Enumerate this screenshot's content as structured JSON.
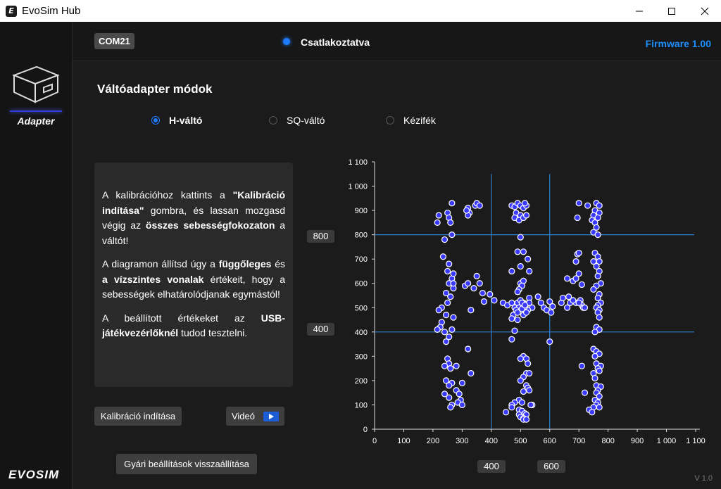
{
  "window": {
    "title": "EvoSim Hub",
    "icon": "app-logo-icon"
  },
  "sidebar": {
    "adapter_label": "Adapter",
    "brand": "EVOSIM"
  },
  "header": {
    "port": "COM21",
    "status": "Csatlakoztatva",
    "firmware": "Firmware 1.00",
    "status_color": "#1e7bff"
  },
  "main": {
    "title": "Váltóadapter módok",
    "modes": [
      {
        "label": "H-váltó",
        "selected": true
      },
      {
        "label": "SQ-váltó",
        "selected": false
      },
      {
        "label": "Kézifék",
        "selected": false
      }
    ],
    "info": {
      "p1_a": "A kalibrációhoz kattints a ",
      "p1_b": "\"Kalibráció indítása\"",
      "p1_c": " gombra, és lassan mozgasd végig az ",
      "p1_d": "összes sebességfokozaton",
      "p1_e": " a váltót!",
      "p2_a": "A diagramon állítsd úgy a ",
      "p2_b": "függőleges",
      "p2_c": " és ",
      "p2_d": "a vízszintes vonalak",
      "p2_e": " értékeit, hogy a sebességek elhatárolódjanak egymástól!",
      "p3_a": "A beállított értékeket az ",
      "p3_b": "USB-játékvezérlőknél",
      "p3_c": " tudod tesztelni."
    },
    "buttons": {
      "calibrate": "Kalibráció indítása",
      "video": "Videó",
      "reset": "Gyári beállítások visszaállítása"
    },
    "y_upper": "800",
    "y_lower": "400",
    "x_left": "400",
    "x_right": "600",
    "version": "V 1.0"
  },
  "chart_data": {
    "type": "scatter",
    "x_ticks": [
      "0",
      "100",
      "200",
      "300",
      "400",
      "500",
      "600",
      "700",
      "800",
      "900",
      "1 000",
      "1 100"
    ],
    "y_ticks": [
      "0",
      "100",
      "200",
      "300",
      "400",
      "500",
      "600",
      "700",
      "800",
      "900",
      "1 000",
      "1 100"
    ],
    "xlim": [
      0,
      1100
    ],
    "ylim": [
      0,
      1100
    ],
    "vertical_lines": [
      400,
      600
    ],
    "horizontal_lines": [
      400,
      800
    ],
    "line_color": "#2f7fd0",
    "point_color": "#3a3aff",
    "grid": false,
    "points": [
      [
        220,
        880
      ],
      [
        215,
        850
      ],
      [
        265,
        930
      ],
      [
        250,
        890
      ],
      [
        255,
        870
      ],
      [
        260,
        850
      ],
      [
        240,
        780
      ],
      [
        265,
        800
      ],
      [
        235,
        710
      ],
      [
        255,
        680
      ],
      [
        250,
        650
      ],
      [
        265,
        620
      ],
      [
        255,
        600
      ],
      [
        270,
        580
      ],
      [
        245,
        560
      ],
      [
        260,
        545
      ],
      [
        250,
        520
      ],
      [
        230,
        500
      ],
      [
        220,
        490
      ],
      [
        245,
        470
      ],
      [
        230,
        440
      ],
      [
        225,
        420
      ],
      [
        215,
        410
      ],
      [
        240,
        400
      ],
      [
        255,
        380
      ],
      [
        245,
        360
      ],
      [
        265,
        410
      ],
      [
        270,
        460
      ],
      [
        270,
        640
      ],
      [
        270,
        600
      ],
      [
        250,
        290
      ],
      [
        255,
        270
      ],
      [
        260,
        250
      ],
      [
        240,
        260
      ],
      [
        280,
        260
      ],
      [
        245,
        200
      ],
      [
        265,
        190
      ],
      [
        255,
        180
      ],
      [
        280,
        160
      ],
      [
        290,
        145
      ],
      [
        295,
        120
      ],
      [
        265,
        100
      ],
      [
        260,
        90
      ],
      [
        285,
        110
      ],
      [
        300,
        100
      ],
      [
        240,
        145
      ],
      [
        255,
        130
      ],
      [
        300,
        190
      ],
      [
        330,
        230
      ],
      [
        320,
        330
      ],
      [
        310,
        590
      ],
      [
        320,
        600
      ],
      [
        340,
        580
      ],
      [
        350,
        630
      ],
      [
        360,
        600
      ],
      [
        370,
        560
      ],
      [
        375,
        525
      ],
      [
        330,
        490
      ],
      [
        395,
        555
      ],
      [
        410,
        530
      ],
      [
        345,
        920
      ],
      [
        350,
        930
      ],
      [
        360,
        920
      ],
      [
        320,
        910
      ],
      [
        325,
        890
      ],
      [
        320,
        880
      ],
      [
        315,
        900
      ],
      [
        470,
        920
      ],
      [
        480,
        915
      ],
      [
        490,
        930
      ],
      [
        500,
        920
      ],
      [
        510,
        910
      ],
      [
        520,
        920
      ],
      [
        515,
        930
      ],
      [
        485,
        890
      ],
      [
        500,
        880
      ],
      [
        480,
        870
      ],
      [
        495,
        860
      ],
      [
        510,
        870
      ],
      [
        520,
        880
      ],
      [
        500,
        790
      ],
      [
        490,
        730
      ],
      [
        510,
        730
      ],
      [
        525,
        700
      ],
      [
        500,
        670
      ],
      [
        470,
        650
      ],
      [
        530,
        650
      ],
      [
        500,
        600
      ],
      [
        510,
        610
      ],
      [
        505,
        590
      ],
      [
        495,
        575
      ],
      [
        490,
        565
      ],
      [
        440,
        520
      ],
      [
        455,
        510
      ],
      [
        470,
        520
      ],
      [
        480,
        500
      ],
      [
        490,
        520
      ],
      [
        500,
        530
      ],
      [
        510,
        520
      ],
      [
        520,
        515
      ],
      [
        530,
        540
      ],
      [
        540,
        500
      ],
      [
        525,
        490
      ],
      [
        515,
        505
      ],
      [
        505,
        520
      ],
      [
        495,
        500
      ],
      [
        485,
        490
      ],
      [
        475,
        470
      ],
      [
        470,
        455
      ],
      [
        490,
        450
      ],
      [
        510,
        470
      ],
      [
        520,
        480
      ],
      [
        530,
        520
      ],
      [
        560,
        545
      ],
      [
        570,
        520
      ],
      [
        580,
        500
      ],
      [
        590,
        490
      ],
      [
        600,
        525
      ],
      [
        490,
        480
      ],
      [
        505,
        495
      ],
      [
        515,
        510
      ],
      [
        470,
        370
      ],
      [
        480,
        405
      ],
      [
        510,
        300
      ],
      [
        500,
        290
      ],
      [
        520,
        290
      ],
      [
        525,
        270
      ],
      [
        520,
        230
      ],
      [
        530,
        230
      ],
      [
        510,
        215
      ],
      [
        500,
        200
      ],
      [
        520,
        180
      ],
      [
        525,
        170
      ],
      [
        530,
        160
      ],
      [
        510,
        155
      ],
      [
        495,
        120
      ],
      [
        505,
        110
      ],
      [
        480,
        110
      ],
      [
        470,
        100
      ],
      [
        495,
        80
      ],
      [
        505,
        75
      ],
      [
        515,
        65
      ],
      [
        520,
        60
      ],
      [
        495,
        60
      ],
      [
        500,
        50
      ],
      [
        510,
        45
      ],
      [
        540,
        100
      ],
      [
        450,
        70
      ],
      [
        470,
        90
      ],
      [
        510,
        40
      ],
      [
        535,
        100
      ],
      [
        520,
        40
      ],
      [
        600,
        360
      ],
      [
        605,
        480
      ],
      [
        610,
        505
      ],
      [
        640,
        520
      ],
      [
        660,
        500
      ],
      [
        670,
        520
      ],
      [
        690,
        520
      ],
      [
        710,
        510
      ],
      [
        705,
        530
      ],
      [
        715,
        500
      ],
      [
        720,
        500
      ],
      [
        645,
        540
      ],
      [
        665,
        545
      ],
      [
        680,
        530
      ],
      [
        700,
        520
      ],
      [
        700,
        930
      ],
      [
        730,
        920
      ],
      [
        760,
        930
      ],
      [
        770,
        920
      ],
      [
        755,
        900
      ],
      [
        770,
        890
      ],
      [
        750,
        880
      ],
      [
        765,
        870
      ],
      [
        695,
        870
      ],
      [
        745,
        860
      ],
      [
        755,
        850
      ],
      [
        760,
        830
      ],
      [
        750,
        810
      ],
      [
        765,
        800
      ],
      [
        695,
        720
      ],
      [
        700,
        725
      ],
      [
        755,
        725
      ],
      [
        765,
        710
      ],
      [
        750,
        690
      ],
      [
        770,
        690
      ],
      [
        760,
        670
      ],
      [
        770,
        650
      ],
      [
        765,
        630
      ],
      [
        775,
        600
      ],
      [
        760,
        590
      ],
      [
        750,
        575
      ],
      [
        770,
        555
      ],
      [
        765,
        540
      ],
      [
        775,
        520
      ],
      [
        765,
        510
      ],
      [
        760,
        500
      ],
      [
        770,
        490
      ],
      [
        765,
        480
      ],
      [
        770,
        460
      ],
      [
        760,
        420
      ],
      [
        770,
        410
      ],
      [
        755,
        400
      ],
      [
        690,
        690
      ],
      [
        700,
        640
      ],
      [
        680,
        610
      ],
      [
        660,
        620
      ],
      [
        690,
        620
      ],
      [
        710,
        595
      ],
      [
        750,
        330
      ],
      [
        760,
        320
      ],
      [
        770,
        310
      ],
      [
        755,
        300
      ],
      [
        760,
        270
      ],
      [
        775,
        260
      ],
      [
        765,
        250
      ],
      [
        770,
        240
      ],
      [
        750,
        230
      ],
      [
        755,
        210
      ],
      [
        760,
        180
      ],
      [
        775,
        175
      ],
      [
        765,
        160
      ],
      [
        760,
        150
      ],
      [
        770,
        135
      ],
      [
        755,
        120
      ],
      [
        765,
        110
      ],
      [
        760,
        100
      ],
      [
        750,
        90
      ],
      [
        735,
        80
      ],
      [
        745,
        70
      ],
      [
        720,
        150
      ],
      [
        710,
        260
      ],
      [
        770,
        90
      ]
    ]
  }
}
